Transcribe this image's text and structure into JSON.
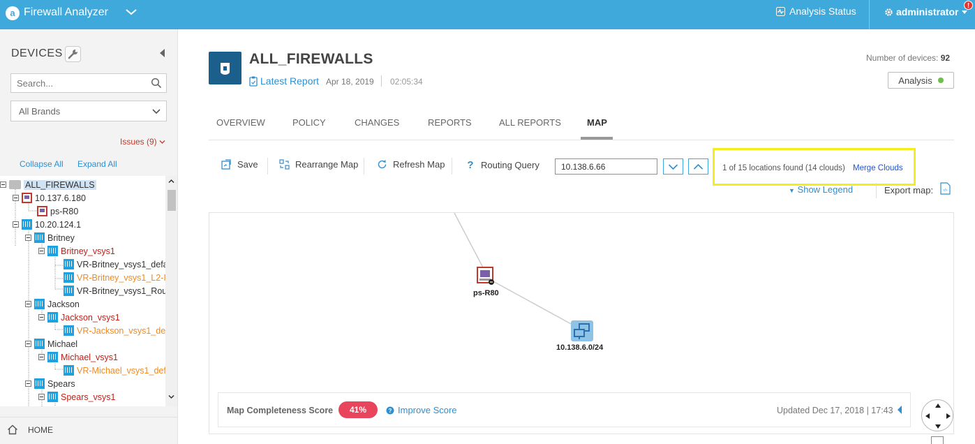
{
  "topbar": {
    "app_title": "Firewall Analyzer",
    "analysis_status": "Analysis Status",
    "user": "administrator",
    "alert_badge": "!"
  },
  "sidebar": {
    "title": "DEVICES",
    "search_placeholder": "Search...",
    "brand_filter": "All Brands",
    "issues": "Issues (9)",
    "collapse_all": "Collapse All",
    "expand_all": "Expand All",
    "home": "HOME",
    "tree": [
      {
        "label": "ALL_FIREWALLS",
        "icon": "folder-icon",
        "color": "dark",
        "selected": true
      },
      {
        "label": "10.137.6.180",
        "icon": "checkpoint-icon",
        "color": "dark"
      },
      {
        "label": "ps-R80",
        "icon": "checkpoint-icon",
        "color": "dark"
      },
      {
        "label": "10.20.124.1",
        "icon": "firewall-icon",
        "color": "dark"
      },
      {
        "label": "Britney",
        "icon": "firewall-icon",
        "color": "dark"
      },
      {
        "label": "Britney_vsys1",
        "icon": "firewall-icon",
        "color": "red"
      },
      {
        "label": "VR-Britney_vsys1_defa",
        "icon": "firewall-icon",
        "color": "dark"
      },
      {
        "label": "VR-Britney_vsys1_L2-I",
        "icon": "firewall-icon",
        "color": "orange"
      },
      {
        "label": "VR-Britney_vsys1_Rou",
        "icon": "firewall-icon",
        "color": "dark"
      },
      {
        "label": "Jackson",
        "icon": "firewall-icon",
        "color": "dark"
      },
      {
        "label": "Jackson_vsys1",
        "icon": "firewall-icon",
        "color": "red"
      },
      {
        "label": "VR-Jackson_vsys1_de",
        "icon": "firewall-icon",
        "color": "orange"
      },
      {
        "label": "Michael",
        "icon": "firewall-icon",
        "color": "dark"
      },
      {
        "label": "Michael_vsys1",
        "icon": "firewall-icon",
        "color": "red"
      },
      {
        "label": "VR-Michael_vsys1_def",
        "icon": "firewall-icon",
        "color": "orange"
      },
      {
        "label": "Spears",
        "icon": "firewall-icon",
        "color": "dark"
      },
      {
        "label": "Spears_vsys1",
        "icon": "firewall-icon",
        "color": "red"
      }
    ]
  },
  "main": {
    "title": "ALL_FIREWALLS",
    "latest_report": "Latest Report",
    "report_date": "Apr 18, 2019",
    "report_time": "02:05:34",
    "num_devices_label": "Number of devices:",
    "num_devices": "92",
    "analysis_button": "Analysis",
    "tabs": [
      "OVERVIEW",
      "POLICY",
      "CHANGES",
      "REPORTS",
      "ALL REPORTS",
      "MAP"
    ],
    "active_tab": "MAP"
  },
  "toolbar": {
    "save": "Save",
    "rearrange": "Rearrange Map",
    "refresh": "Refresh Map",
    "routing": "Routing Query",
    "ip_value": "10.138.6.66",
    "found": "1 of 15 locations found (14 clouds)",
    "merge": "Merge Clouds",
    "show_legend": "Show Legend",
    "export": "Export map:"
  },
  "map": {
    "nodes": [
      {
        "label": "ps-R80",
        "icon": "checkpoint-icon"
      },
      {
        "label": "10.138.6.0/24",
        "icon": "network-cloud-icon"
      }
    ],
    "score_label": "Map Completeness Score",
    "score": "41%",
    "improve": "Improve Score",
    "updated": "Updated Dec 17, 2018 | 17:43"
  },
  "colors": {
    "topbar": "#3fa9dc",
    "accent": "#2f8fd0",
    "score": "#e8455c",
    "highlight": "#f4ee1e",
    "status_ok": "#6cc04a"
  }
}
